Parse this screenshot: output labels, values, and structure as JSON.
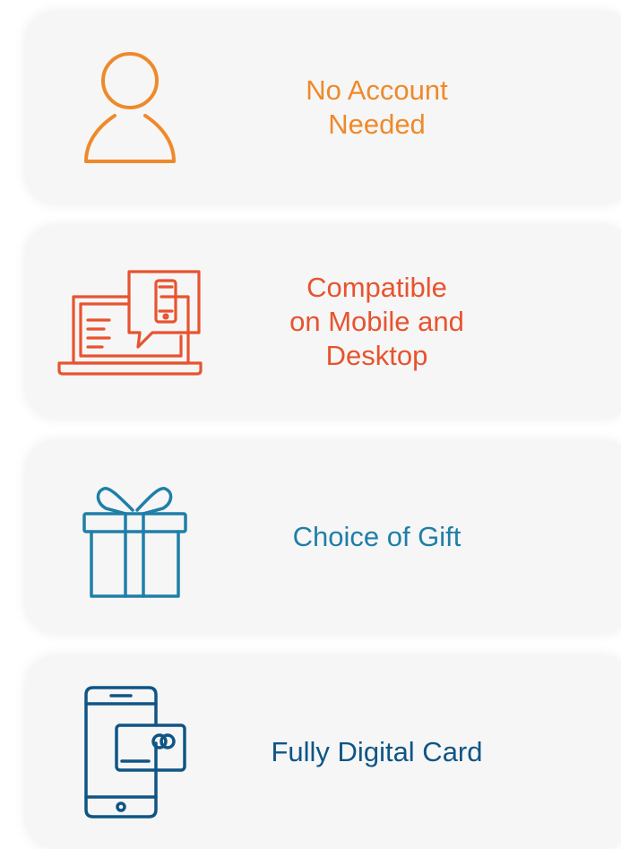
{
  "features": [
    {
      "label": "No Account\nNeeded",
      "icon": "user-icon",
      "color": "#ee8a2a"
    },
    {
      "label": "Compatible\non Mobile and\nDesktop",
      "icon": "laptop-mobile-icon",
      "color": "#e8532e"
    },
    {
      "label": "Choice of Gift",
      "icon": "gift-icon",
      "color": "#1f7fa8"
    },
    {
      "label": "Fully Digital Card",
      "icon": "phone-card-icon",
      "color": "#0f5585"
    }
  ]
}
